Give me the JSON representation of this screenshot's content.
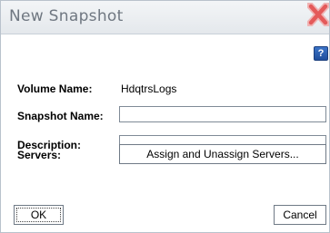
{
  "window": {
    "title": "New Snapshot",
    "help_label": "?"
  },
  "form": {
    "volume_name_label": "Volume Name:",
    "volume_name_value": "HdqtrsLogs",
    "snapshot_name_label": "Snapshot Name:",
    "snapshot_name_value": "",
    "description_label": "Description:",
    "description_value": "",
    "servers_label": "Servers:",
    "assign_button_label": "Assign and Unassign Servers..."
  },
  "footer": {
    "ok_label": "OK",
    "cancel_label": "Cancel"
  },
  "colors": {
    "close_icon": "#e45a5a",
    "help_icon": "#2b5fb3"
  }
}
